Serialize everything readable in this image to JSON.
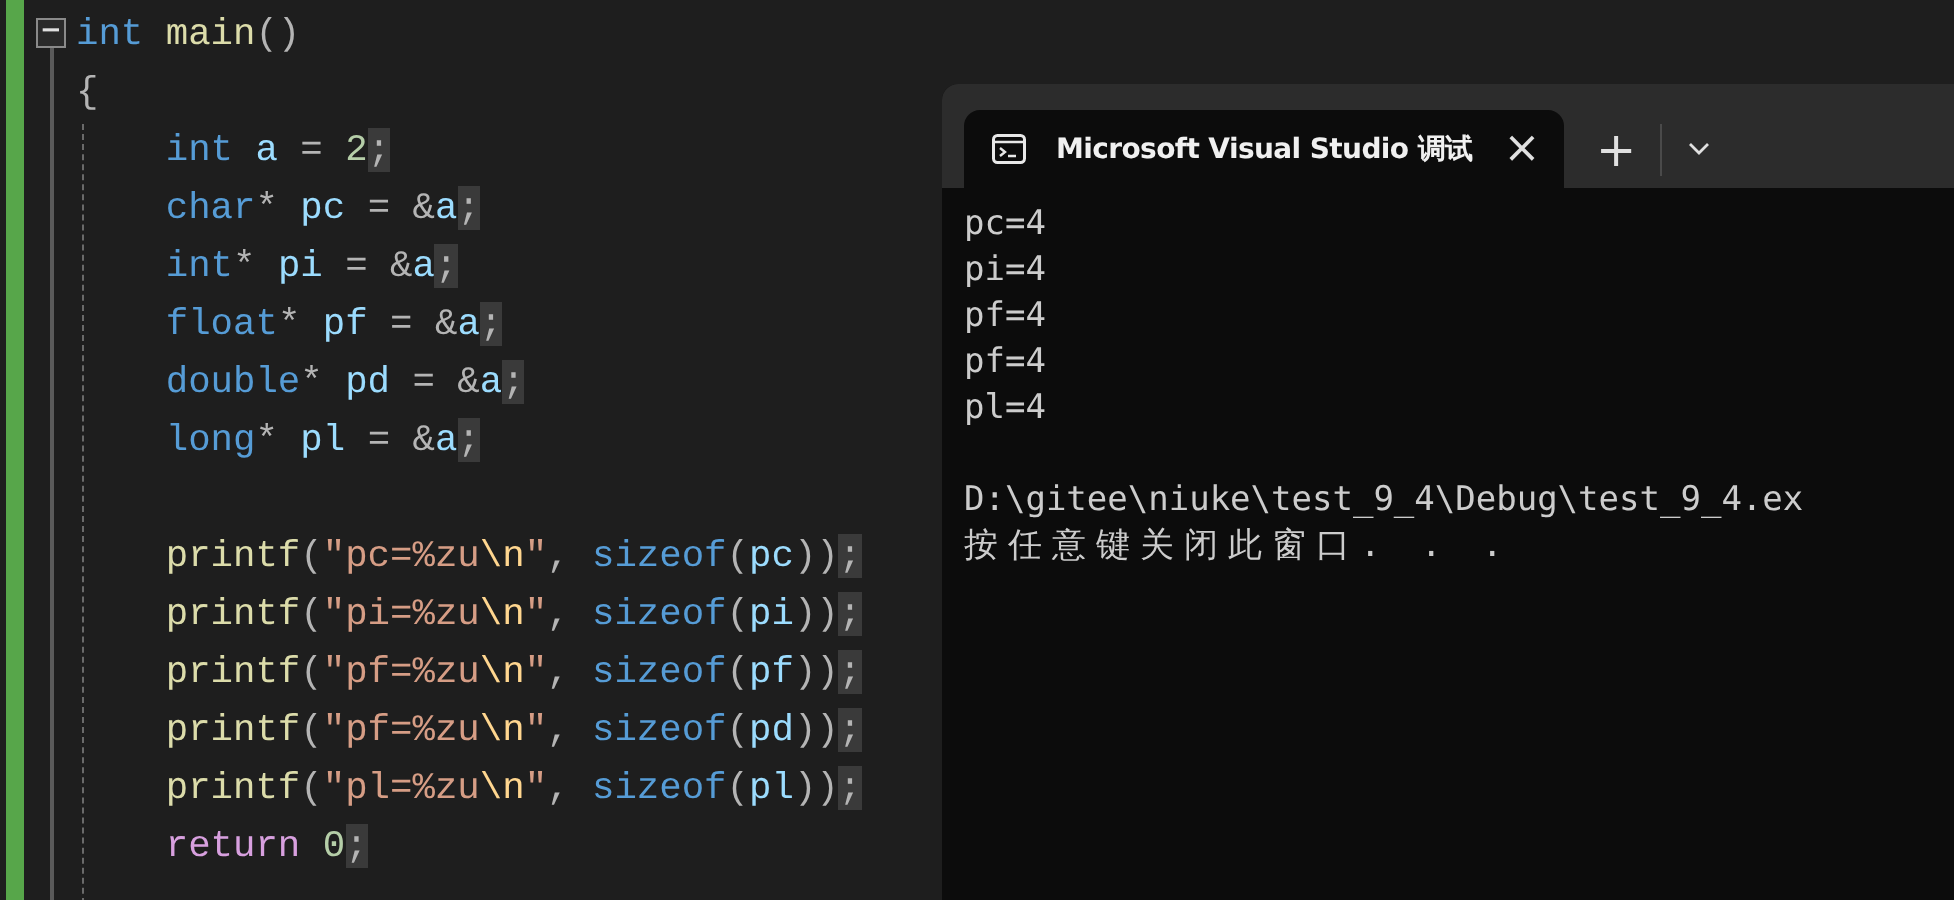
{
  "editor": {
    "collapse_toggle": "−",
    "lines": [
      {
        "kind": "code",
        "tokens": [
          {
            "text": "int ",
            "kind": "keyword"
          },
          {
            "text": "main",
            "kind": "function"
          },
          {
            "text": "()",
            "kind": "punct"
          }
        ]
      },
      {
        "kind": "code",
        "tokens": [
          {
            "text": "{",
            "kind": "punct"
          }
        ]
      },
      {
        "kind": "code",
        "tokens": [
          {
            "text": "    int",
            "kind": "keyword"
          },
          {
            "text": " a ",
            "kind": "variable"
          },
          {
            "text": "= ",
            "kind": "punct"
          },
          {
            "text": "2",
            "kind": "number"
          },
          {
            "text": ";",
            "kind": "marked"
          }
        ]
      },
      {
        "kind": "code",
        "tokens": [
          {
            "text": "    char",
            "kind": "keyword"
          },
          {
            "text": "* ",
            "kind": "punct"
          },
          {
            "text": "pc ",
            "kind": "variable"
          },
          {
            "text": "= &",
            "kind": "punct"
          },
          {
            "text": "a",
            "kind": "variable"
          },
          {
            "text": ";",
            "kind": "marked"
          }
        ]
      },
      {
        "kind": "code",
        "tokens": [
          {
            "text": "    int",
            "kind": "keyword"
          },
          {
            "text": "* ",
            "kind": "punct"
          },
          {
            "text": "pi ",
            "kind": "variable"
          },
          {
            "text": "= &",
            "kind": "punct"
          },
          {
            "text": "a",
            "kind": "variable"
          },
          {
            "text": ";",
            "kind": "marked"
          }
        ]
      },
      {
        "kind": "code",
        "tokens": [
          {
            "text": "    float",
            "kind": "keyword"
          },
          {
            "text": "* ",
            "kind": "punct"
          },
          {
            "text": "pf ",
            "kind": "variable"
          },
          {
            "text": "= &",
            "kind": "punct"
          },
          {
            "text": "a",
            "kind": "variable"
          },
          {
            "text": ";",
            "kind": "marked"
          }
        ]
      },
      {
        "kind": "code",
        "tokens": [
          {
            "text": "    double",
            "kind": "keyword"
          },
          {
            "text": "* ",
            "kind": "punct"
          },
          {
            "text": "pd ",
            "kind": "variable"
          },
          {
            "text": "= &",
            "kind": "punct"
          },
          {
            "text": "a",
            "kind": "variable"
          },
          {
            "text": ";",
            "kind": "marked"
          }
        ]
      },
      {
        "kind": "code",
        "tokens": [
          {
            "text": "    long",
            "kind": "keyword"
          },
          {
            "text": "* ",
            "kind": "punct"
          },
          {
            "text": "pl ",
            "kind": "variable"
          },
          {
            "text": "= &",
            "kind": "punct"
          },
          {
            "text": "a",
            "kind": "variable"
          },
          {
            "text": ";",
            "kind": "marked"
          }
        ]
      },
      {
        "kind": "blank"
      },
      {
        "kind": "code",
        "tokens": [
          {
            "text": "    printf",
            "kind": "function"
          },
          {
            "text": "(",
            "kind": "punct"
          },
          {
            "text": "\"pc=%zu",
            "kind": "string"
          },
          {
            "text": "\\n",
            "kind": "escape"
          },
          {
            "text": "\"",
            "kind": "string"
          },
          {
            "text": ", ",
            "kind": "punct"
          },
          {
            "text": "sizeof",
            "kind": "keyword"
          },
          {
            "text": "(",
            "kind": "punct"
          },
          {
            "text": "pc",
            "kind": "variable"
          },
          {
            "text": "))",
            "kind": "punct"
          },
          {
            "text": ";",
            "kind": "marked"
          }
        ]
      },
      {
        "kind": "code",
        "tokens": [
          {
            "text": "    printf",
            "kind": "function"
          },
          {
            "text": "(",
            "kind": "punct"
          },
          {
            "text": "\"pi=%zu",
            "kind": "string"
          },
          {
            "text": "\\n",
            "kind": "escape"
          },
          {
            "text": "\"",
            "kind": "string"
          },
          {
            "text": ", ",
            "kind": "punct"
          },
          {
            "text": "sizeof",
            "kind": "keyword"
          },
          {
            "text": "(",
            "kind": "punct"
          },
          {
            "text": "pi",
            "kind": "variable"
          },
          {
            "text": "))",
            "kind": "punct"
          },
          {
            "text": ";",
            "kind": "marked"
          }
        ]
      },
      {
        "kind": "code",
        "tokens": [
          {
            "text": "    printf",
            "kind": "function"
          },
          {
            "text": "(",
            "kind": "punct"
          },
          {
            "text": "\"pf=%zu",
            "kind": "string"
          },
          {
            "text": "\\n",
            "kind": "escape"
          },
          {
            "text": "\"",
            "kind": "string"
          },
          {
            "text": ", ",
            "kind": "punct"
          },
          {
            "text": "sizeof",
            "kind": "keyword"
          },
          {
            "text": "(",
            "kind": "punct"
          },
          {
            "text": "pf",
            "kind": "variable"
          },
          {
            "text": "))",
            "kind": "punct"
          },
          {
            "text": ";",
            "kind": "marked"
          }
        ]
      },
      {
        "kind": "code",
        "tokens": [
          {
            "text": "    printf",
            "kind": "function"
          },
          {
            "text": "(",
            "kind": "punct"
          },
          {
            "text": "\"pf=%zu",
            "kind": "string"
          },
          {
            "text": "\\n",
            "kind": "escape"
          },
          {
            "text": "\"",
            "kind": "string"
          },
          {
            "text": ", ",
            "kind": "punct"
          },
          {
            "text": "sizeof",
            "kind": "keyword"
          },
          {
            "text": "(",
            "kind": "punct"
          },
          {
            "text": "pd",
            "kind": "variable"
          },
          {
            "text": "))",
            "kind": "punct"
          },
          {
            "text": ";",
            "kind": "marked"
          }
        ]
      },
      {
        "kind": "code",
        "tokens": [
          {
            "text": "    printf",
            "kind": "function"
          },
          {
            "text": "(",
            "kind": "punct"
          },
          {
            "text": "\"pl=%zu",
            "kind": "string"
          },
          {
            "text": "\\n",
            "kind": "escape"
          },
          {
            "text": "\"",
            "kind": "string"
          },
          {
            "text": ", ",
            "kind": "punct"
          },
          {
            "text": "sizeof",
            "kind": "keyword"
          },
          {
            "text": "(",
            "kind": "punct"
          },
          {
            "text": "pl",
            "kind": "variable"
          },
          {
            "text": "))",
            "kind": "punct"
          },
          {
            "text": ";",
            "kind": "marked"
          }
        ]
      },
      {
        "kind": "code",
        "tokens": [
          {
            "text": "    return ",
            "kind": "control"
          },
          {
            "text": "0",
            "kind": "number"
          },
          {
            "text": ";",
            "kind": "marked"
          }
        ]
      }
    ]
  },
  "terminal": {
    "tab": {
      "title": "Microsoft Visual Studio 调试",
      "close": "×",
      "selected": true
    },
    "new_tab": "+",
    "output": [
      "pc=4",
      "pi=4",
      "pf=4",
      "pf=4",
      "pl=4"
    ],
    "message": [
      "D:\\gitee\\niuke\\test_9_4\\Debug\\test_9_4.ex",
      "按任意键关闭此窗口. . ."
    ]
  }
}
